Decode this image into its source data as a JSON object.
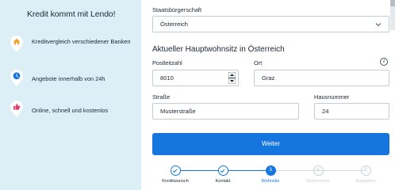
{
  "left_panel": {
    "title": "Kredit kommt mit Lendo!",
    "benefits": [
      {
        "icon": "house-icon",
        "label": "Kreditvergleich verschiedener Banken"
      },
      {
        "icon": "clock-icon",
        "label": "Angebote innerhalb von 24h"
      },
      {
        "icon": "thumbs-up-icon",
        "label": "Online, schnell und kostenlos"
      }
    ],
    "colors": {
      "background": "#dceff7",
      "pin": "#ffffff",
      "house_icon": "#f29f35",
      "clock_icon": "#1676e0",
      "thumbs_icon": "#e43c6e"
    }
  },
  "form": {
    "citizenship": {
      "label": "Staatsbürgerschaft",
      "value": "Österreich"
    },
    "section_title": "Aktueller Hauptwohnsitz in Österreich",
    "postal_code": {
      "label": "Postleitzahl",
      "value": "8010"
    },
    "city": {
      "label": "Ort",
      "value": "Graz",
      "info_icon": "info-icon"
    },
    "street": {
      "label": "Straße",
      "value": "Musterstraße"
    },
    "house_number": {
      "label": "Hausnummer",
      "value": "24"
    },
    "submit_label": "Weiter",
    "colors": {
      "primary": "#1676e0",
      "border": "#c6ccd3",
      "disabled": "#c9ced4"
    }
  },
  "stepper": {
    "steps": [
      {
        "label": "Kreditwunsch",
        "state": "done",
        "number": ""
      },
      {
        "label": "Kontakt",
        "state": "done",
        "number": ""
      },
      {
        "label": "Wohnsitz",
        "state": "active",
        "number": "3"
      },
      {
        "label": "Einkommen",
        "state": "todo",
        "number": "4"
      },
      {
        "label": "Ausgaben",
        "state": "todo",
        "number": "5"
      }
    ]
  }
}
